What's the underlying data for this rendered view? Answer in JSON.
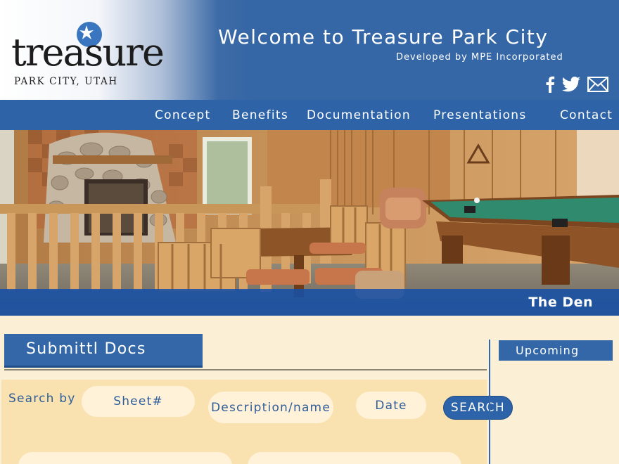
{
  "logo": {
    "word": "treasure",
    "subtitle": "PARK CITY, UTAH"
  },
  "header": {
    "title": "Welcome to Treasure Park City",
    "subtitle": "Developed by MPE Incorporated",
    "social": [
      {
        "icon": "facebook-icon"
      },
      {
        "icon": "twitter-icon"
      },
      {
        "icon": "email-icon"
      }
    ]
  },
  "nav": {
    "items": [
      {
        "label": "Concept"
      },
      {
        "label": "Benefits"
      },
      {
        "label": "Documentation"
      },
      {
        "label": "Presentations"
      },
      {
        "label": "Contact"
      }
    ]
  },
  "hero": {
    "caption": "The Den"
  },
  "main": {
    "section_title": "Submittl Docs",
    "search": {
      "label": "Search by",
      "sheet": "Sheet#",
      "description": "Description/name",
      "date": "Date",
      "button": "SEARCH"
    }
  },
  "sidebar": {
    "title": "Upcoming"
  },
  "colors": {
    "brand_blue": "#3467a8",
    "nav_blue": "#2e63a8",
    "panel": "#fae2b0",
    "pill": "#fff2d8",
    "page": "#fbf0d6"
  }
}
